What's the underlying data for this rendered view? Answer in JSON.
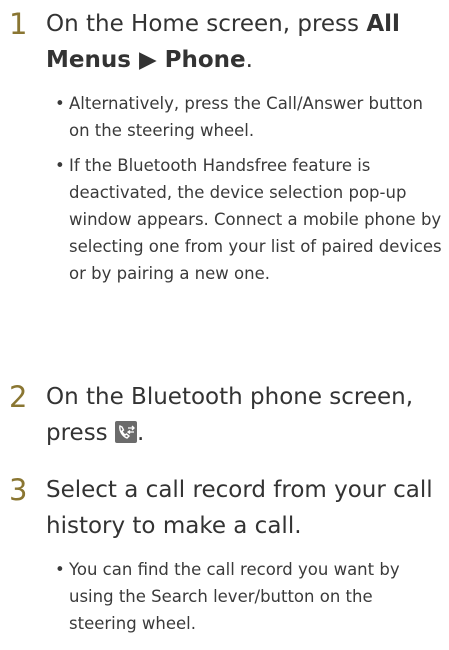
{
  "steps": [
    {
      "number": "1",
      "text_before": "On the Home screen, press ",
      "bold1": "All Menus",
      "arrow": " ▶ ",
      "bold2": "Phone",
      "text_after": ".",
      "bullets": [
        "Alternatively, press the Call/Answer button on the steering wheel.",
        "If the Bluetooth Handsfree feature is deactivated, the device selection pop-up window appears. Connect a mobile phone by selecting one from your list of paired devices or by pairing a new one."
      ]
    },
    {
      "number": "2",
      "text_before": "On the Bluetooth phone screen, press ",
      "icon": "call-history-icon",
      "text_after": "."
    },
    {
      "number": "3",
      "text": "Select a call record from your call history to make a call.",
      "bullets": [
        "You can find the call record you want by using the Search lever/button on the steering wheel."
      ]
    }
  ],
  "colors": {
    "step_number": "#8a7632",
    "text": "#333333"
  }
}
